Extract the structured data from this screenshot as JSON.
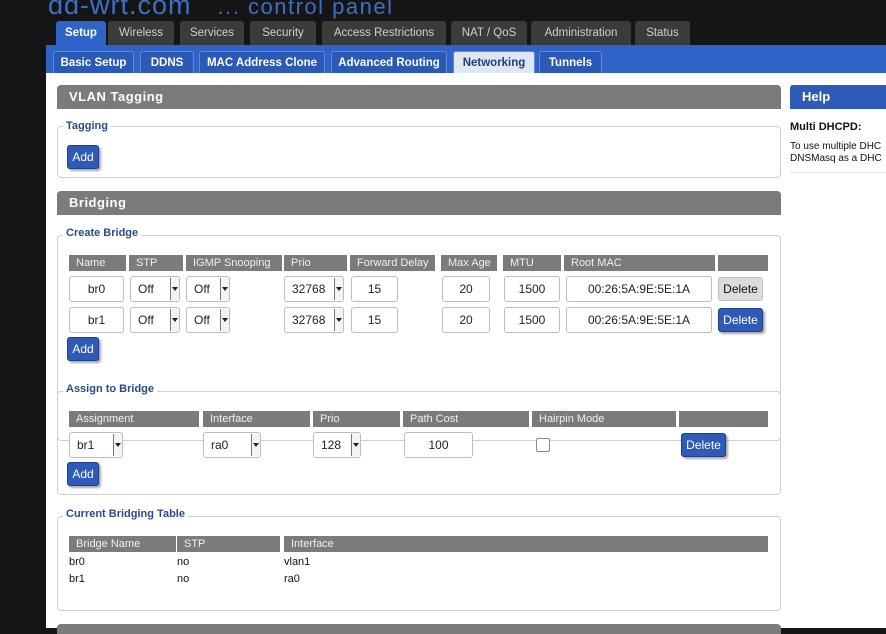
{
  "logo": {
    "brand": "dd-wrt.com",
    "subtitle": "... control panel"
  },
  "main_tabs": [
    "Setup",
    "Wireless",
    "Services",
    "Security",
    "Access Restrictions",
    "NAT / QoS",
    "Administration",
    "Status"
  ],
  "sub_tabs": [
    "Basic Setup",
    "DDNS",
    "MAC Address Clone",
    "Advanced Routing",
    "Networking",
    "Tunnels"
  ],
  "vlan": {
    "title": "VLAN Tagging",
    "legend": "Tagging",
    "add_label": "Add"
  },
  "bridging": {
    "title": "Bridging",
    "create": {
      "legend": "Create Bridge",
      "headers": [
        "Name",
        "STP",
        "IGMP Snooping",
        "Prio",
        "Forward Delay",
        "Max Age",
        "MTU",
        "Root MAC",
        ""
      ],
      "rows": [
        {
          "name": "br0",
          "stp": "Off",
          "igmp": "Off",
          "prio": "32768",
          "fwd_delay": "15",
          "max_age": "20",
          "mtu": "1500",
          "root_mac": "00:26:5A:9E:5E:1A",
          "delete": "Delete"
        },
        {
          "name": "br1",
          "stp": "Off",
          "igmp": "Off",
          "prio": "32768",
          "fwd_delay": "15",
          "max_age": "20",
          "mtu": "1500",
          "root_mac": "00:26:5A:9E:5E:1A",
          "delete": "Delete"
        }
      ],
      "add_label": "Add"
    },
    "assign": {
      "legend": "Assign to Bridge",
      "headers": [
        "Assignment",
        "Interface",
        "Prio",
        "Path Cost",
        "Hairpin Mode",
        ""
      ],
      "rows": [
        {
          "assignment": "br1",
          "interface": "ra0",
          "prio": "128",
          "path_cost": "100",
          "hairpin": false,
          "delete": "Delete"
        }
      ],
      "add_label": "Add"
    },
    "current": {
      "legend": "Current Bridging Table",
      "headers": [
        "Bridge Name",
        "STP",
        "Interface"
      ],
      "rows": [
        {
          "bridge": "br0",
          "stp": "no",
          "iface": "vlan1"
        },
        {
          "bridge": "br1",
          "stp": "no",
          "iface": "ra0"
        }
      ]
    }
  },
  "help": {
    "title": "Help",
    "topic": "Multi DHCPD:",
    "line1": "To use multiple DHC",
    "line2": "DNSMasq as a DHC"
  },
  "colors": {
    "accent": "#2f63c7",
    "section_header": "#7b7b7b",
    "legend_text": "#2b4a8e"
  }
}
